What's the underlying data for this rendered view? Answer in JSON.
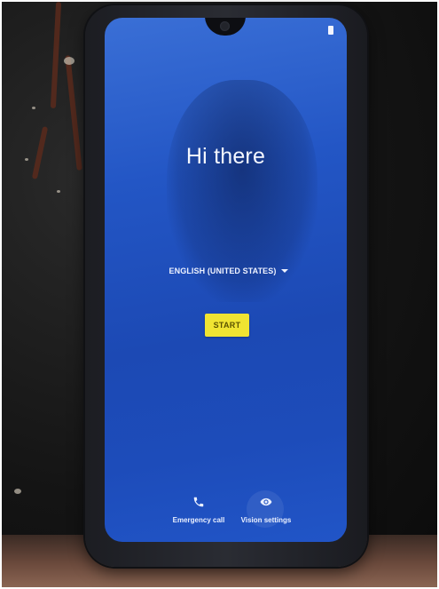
{
  "setup_screen": {
    "greeting": "Hi there",
    "language": {
      "selected": "ENGLISH (UNITED STATES)",
      "icon": "dropdown-arrow-icon"
    },
    "start_button": {
      "label": "START",
      "color": "#f0e432"
    },
    "bottom_actions": [
      {
        "label": "Emergency call",
        "icon": "phone-icon"
      },
      {
        "label": "Vision settings",
        "icon": "eye-icon"
      }
    ],
    "background_color": "#2356c5",
    "status_bar": {
      "icon": "battery-icon"
    }
  }
}
